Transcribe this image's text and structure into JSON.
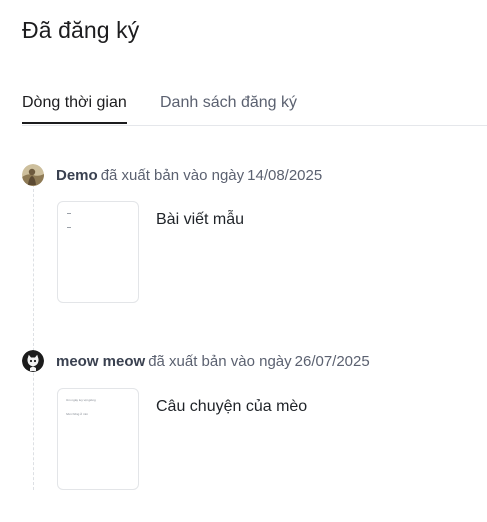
{
  "page": {
    "title": "Đã đăng ký"
  },
  "tabs": [
    {
      "label": "Dòng thời gian",
      "active": true
    },
    {
      "label": "Danh sách đăng ký",
      "active": false
    }
  ],
  "timeline": [
    {
      "author": "Demo",
      "action": "đã xuất bản vào ngày",
      "date": "14/08/2025",
      "post_title": "Bài viết mẫu",
      "avatar_icon": "user-photo-avatar"
    },
    {
      "author": "meow meow",
      "action": "đã xuất bản vào ngày",
      "date": "26/07/2025",
      "post_title": "Câu chuyện của mèo",
      "avatar_icon": "cat-avatar",
      "thumbnail_text": {
        "line1": "Um ngày tuy vội giòng",
        "line2": "hôm hồng ở mìn"
      }
    }
  ],
  "colors": {
    "text_primary": "#1c1c1e",
    "text_secondary": "#5b6170",
    "divider": "#e5e7eb",
    "border": "#e3e5e8"
  }
}
